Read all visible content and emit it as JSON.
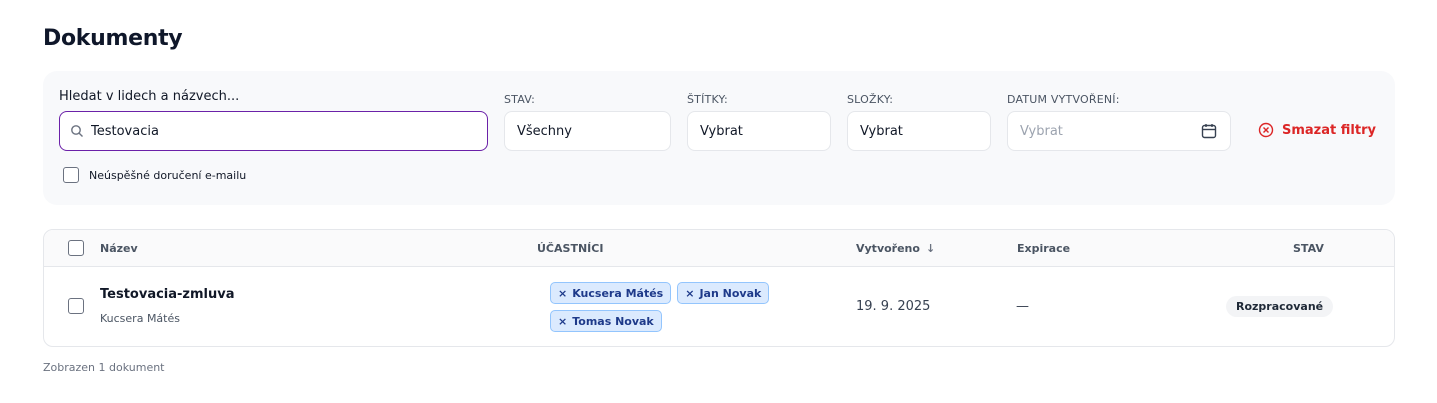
{
  "page": {
    "title": "Dokumenty"
  },
  "filters": {
    "search_label": "Hledat v lidech a názvech...",
    "search_value": "Testovacia",
    "status": {
      "label": "STAV:",
      "value": "Všechny"
    },
    "tags": {
      "label": "ŠTÍTKY:",
      "value": "Vybrat"
    },
    "folders": {
      "label": "SLOŽKY:",
      "value": "Vybrat"
    },
    "created_date": {
      "label": "DATUM VYTVOŘENÍ:",
      "placeholder": "Vybrat"
    },
    "clear_label": "Smazat filtry",
    "email_failed_label": "Neúspěšné doručení e-mailu"
  },
  "table": {
    "headers": {
      "name": "Název",
      "participants": "ÚČASTNÍCI",
      "created": "Vytvořeno",
      "expiration": "Expirace",
      "status": "STAV"
    },
    "rows": [
      {
        "name": "Testovacia-zmluva",
        "owner": "Kucsera Mátés",
        "participants": [
          "Kucsera Mátés",
          "Jan Novak",
          "Tomas Novak"
        ],
        "created": "19. 9. 2025",
        "expiration": "—",
        "status": "Rozpracované"
      }
    ]
  },
  "footer": {
    "count_text": "Zobrazen 1 dokument"
  },
  "colors": {
    "accent": "#6b21a8",
    "danger": "#dc2626",
    "chip_bg": "#dbeafe",
    "chip_text": "#1e3a8a"
  },
  "icons": {
    "search": "search-icon",
    "calendar": "calendar-icon",
    "clear": "x-circle-icon",
    "sort": "arrow-down-icon",
    "chip_remove": "close-icon"
  }
}
